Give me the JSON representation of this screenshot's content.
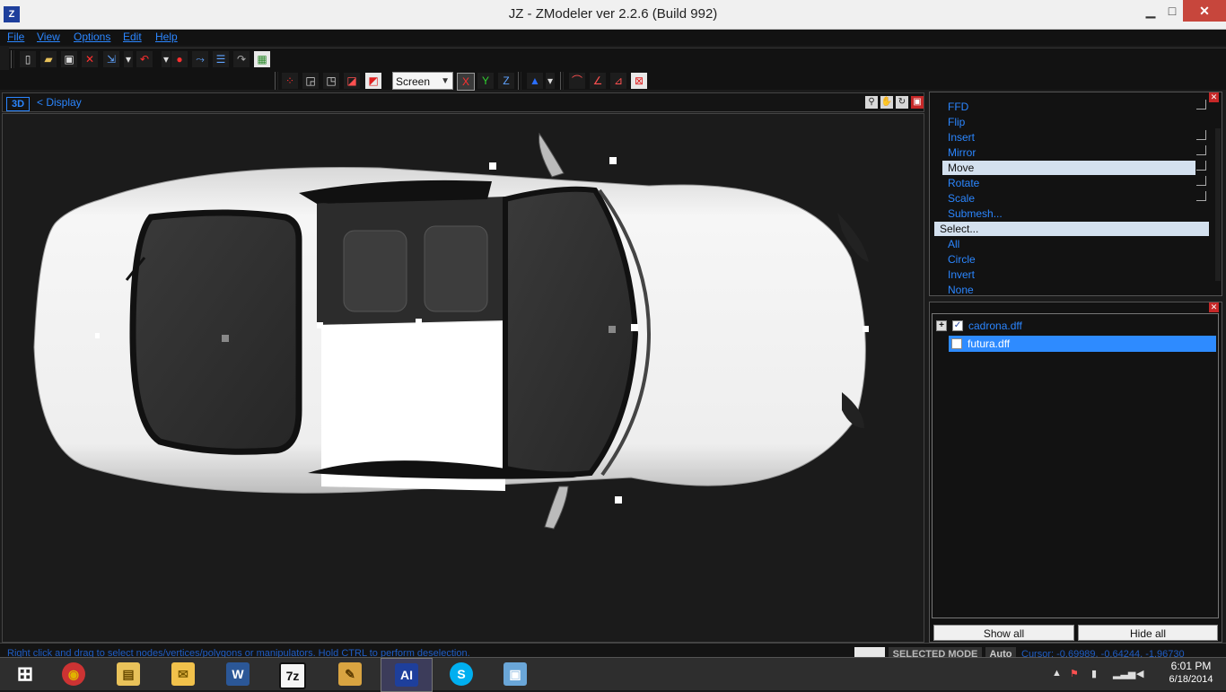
{
  "window": {
    "title": "JZ - ZModeler ver 2.2.6 (Build 992)",
    "app_icon": "zmodeler-icon",
    "minimize": "▁",
    "maximize": "□",
    "close": "✕"
  },
  "menu": [
    "File",
    "View",
    "Options",
    "Edit",
    "Help"
  ],
  "toolbar": {
    "coordinate_system": "Screen",
    "axis_x": "X",
    "axis_y": "Y",
    "axis_z": "Z"
  },
  "viewport": {
    "mode": "3D",
    "label": "<  Display"
  },
  "modifiers": {
    "items": [
      {
        "label": "FFD",
        "kind": "item",
        "box": true
      },
      {
        "label": "Flip",
        "kind": "item",
        "box": false
      },
      {
        "label": "Insert",
        "kind": "item",
        "box": true
      },
      {
        "label": "Mirror",
        "kind": "item",
        "box": true
      },
      {
        "label": "Move",
        "kind": "selected",
        "box": true
      },
      {
        "label": "Rotate",
        "kind": "item",
        "box": true
      },
      {
        "label": "Scale",
        "kind": "item",
        "box": true
      },
      {
        "label": "Submesh...",
        "kind": "item",
        "box": false
      },
      {
        "label": "Select...",
        "kind": "category",
        "box": false
      },
      {
        "label": "All",
        "kind": "item",
        "box": false
      },
      {
        "label": "Circle",
        "kind": "item",
        "box": false
      },
      {
        "label": "Invert",
        "kind": "item",
        "box": false
      },
      {
        "label": "None",
        "kind": "item",
        "box": false
      }
    ]
  },
  "scene": {
    "nodes": [
      {
        "label": "cadrona.dff",
        "checked": true,
        "expandable": true,
        "selected": false
      },
      {
        "label": "futura.dff",
        "checked": false,
        "expandable": false,
        "selected": true
      }
    ],
    "show_all": "Show all",
    "hide_all": "Hide all"
  },
  "status": {
    "hint": "Right click and drag to select nodes/vertices/polygons or manipulators. Hold CTRL to perform deselection.",
    "mode": "SELECTED MODE",
    "auto": "Auto",
    "cursor": "Cursor: -0.69989, -0.64244, -1.96730"
  },
  "taskbar": {
    "apps": [
      {
        "name": "windows-start-icon",
        "glyph": "⊞",
        "color": "#ffffff"
      },
      {
        "name": "chrome-icon",
        "glyph": "◉",
        "color": "#e0b300"
      },
      {
        "name": "file-explorer-icon",
        "glyph": "▤",
        "color": "#e9c25a"
      },
      {
        "name": "outlook-icon",
        "glyph": "✉",
        "color": "#f1c14b"
      },
      {
        "name": "word-icon",
        "glyph": "W",
        "color": "#2b5797"
      },
      {
        "name": "7zip-icon",
        "glyph": "7z",
        "color": "#111111"
      },
      {
        "name": "paint-icon",
        "glyph": "✎",
        "color": "#d9a441"
      },
      {
        "name": "asus-ai-icon",
        "glyph": "AI",
        "color": "#1e3f9c"
      },
      {
        "name": "skype-icon",
        "glyph": "S",
        "color": "#00aff0"
      },
      {
        "name": "photo-viewer-icon",
        "glyph": "▣",
        "color": "#6aa6d8"
      }
    ],
    "time": "6:01 PM",
    "date": "6/18/2014"
  }
}
